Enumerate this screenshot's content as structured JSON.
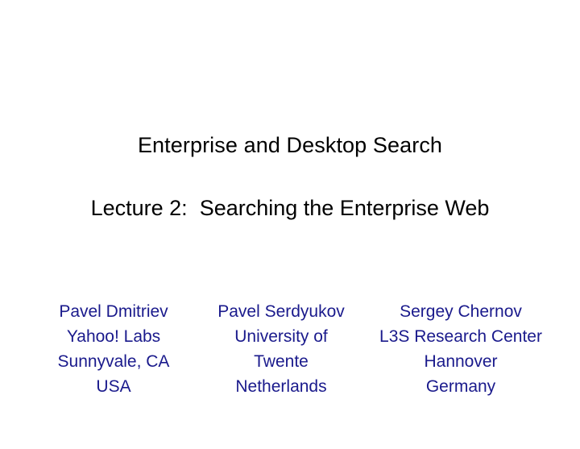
{
  "slide": {
    "background_color": "#ffffff",
    "title_color": "#000000",
    "author_color": "#1a1a8c",
    "title": {
      "line_1": "Enterprise and Desktop Search",
      "line_2": "Lecture 2:  Searching the Enterprise Web"
    },
    "authors": [
      {
        "name": "Pavel Dmitriev",
        "affiliation": "Yahoo! Labs",
        "city": "Sunnyvale, CA",
        "country": "USA"
      },
      {
        "name": "Pavel Serdyukov",
        "affiliation": "University of",
        "city": "Twente",
        "country": "Netherlands"
      },
      {
        "name": "Sergey Chernov",
        "affiliation": "L3S Research Center",
        "city": "Hannover",
        "country": "Germany"
      }
    ]
  }
}
